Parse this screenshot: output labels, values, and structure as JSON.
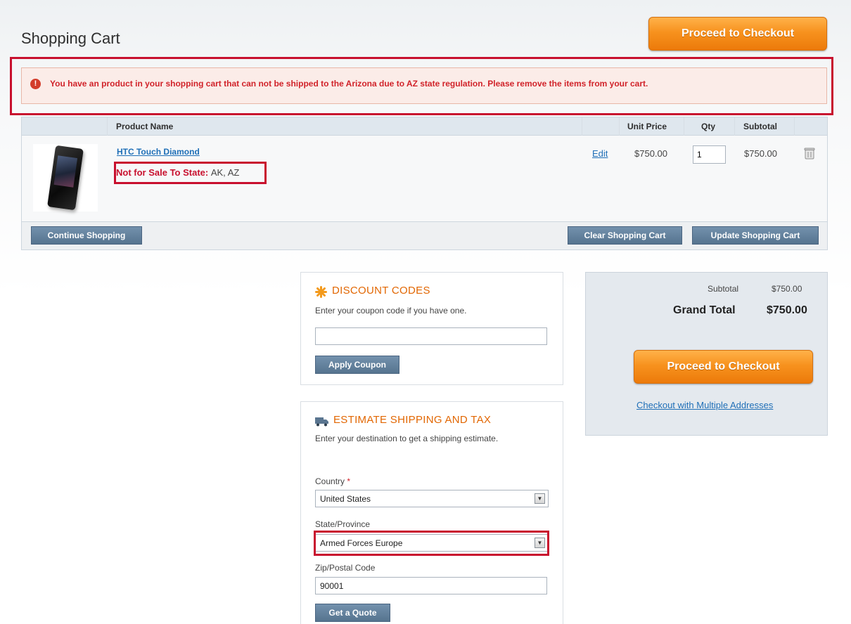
{
  "header": {
    "title": "Shopping Cart",
    "checkout_label": "Proceed to Checkout"
  },
  "error": {
    "message": "You have an product in your shopping cart that can not be shipped to the Arizona due to AZ state regulation. Please remove the items from your cart."
  },
  "cart": {
    "columns": {
      "product_name": "Product Name",
      "unit_price": "Unit Price",
      "qty": "Qty",
      "subtotal": "Subtotal"
    },
    "items": [
      {
        "name": "HTC Touch Diamond",
        "restriction_label": "Not for Sale To State:",
        "restriction_states": "AK, AZ",
        "edit_label": "Edit",
        "unit_price": "$750.00",
        "qty": "1",
        "subtotal": "$750.00"
      }
    ],
    "actions": {
      "continue": "Continue Shopping",
      "clear": "Clear Shopping Cart",
      "update": "Update Shopping Cart"
    }
  },
  "discount": {
    "title": "DISCOUNT CODES",
    "description": "Enter your coupon code if you have one.",
    "coupon_value": "",
    "apply_label": "Apply Coupon"
  },
  "shipping": {
    "title": "ESTIMATE SHIPPING AND TAX",
    "description": "Enter your destination to get a shipping estimate.",
    "country_label": "Country",
    "required_mark": "*",
    "country_value": "United States",
    "state_label": "State/Province",
    "state_value": "Armed Forces Europe",
    "zip_label": "Zip/Postal Code",
    "zip_value": "90001",
    "quote_label": "Get a Quote"
  },
  "totals": {
    "subtotal_label": "Subtotal",
    "subtotal_value": "$750.00",
    "grand_total_label": "Grand Total",
    "grand_total_value": "$750.00",
    "checkout_label": "Proceed to Checkout",
    "multi_address_label": "Checkout with Multiple Addresses"
  },
  "colors": {
    "accent_orange": "#f7921e",
    "error_red": "#c8102e",
    "link_blue": "#1f6fb7",
    "button_blue": "#56748f"
  }
}
